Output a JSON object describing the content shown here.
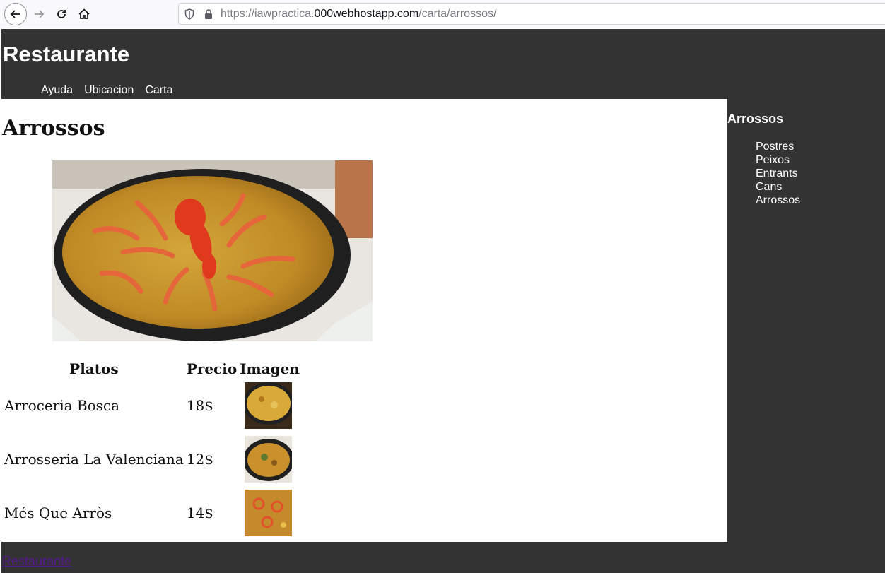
{
  "browser": {
    "url_prefix": "https://iawpractica.",
    "url_host": "000webhostapp.com",
    "url_path": "/carta/arrossos/",
    "icons": [
      "back-arrow-icon",
      "forward-arrow-icon",
      "reload-icon",
      "home-icon",
      "shield-icon",
      "lock-icon"
    ]
  },
  "header": {
    "title": "Restaurante",
    "nav": [
      "Ayuda",
      "Ubicacion",
      "Carta"
    ]
  },
  "main": {
    "heading": "Arrossos",
    "table": {
      "headers": [
        "Platos",
        "Precio",
        "Imagen"
      ],
      "rows": [
        {
          "plato": "Arroceria Bosca",
          "precio": "18$"
        },
        {
          "plato": "Arrosseria La Valenciana",
          "precio": "12$"
        },
        {
          "plato": "Més Que Arròs",
          "precio": "14$"
        }
      ]
    }
  },
  "sidebar": {
    "title": "Arrossos",
    "items": [
      "Postres",
      "Peixos",
      "Entrants",
      "Cans",
      "Arrossos"
    ]
  },
  "footer": {
    "link": "Restaurante"
  },
  "colors": {
    "dark_bg": "#333333",
    "footer_link": "#551a8b",
    "paella_rice": "#c89a2a",
    "pan": "#1f1f1f"
  }
}
